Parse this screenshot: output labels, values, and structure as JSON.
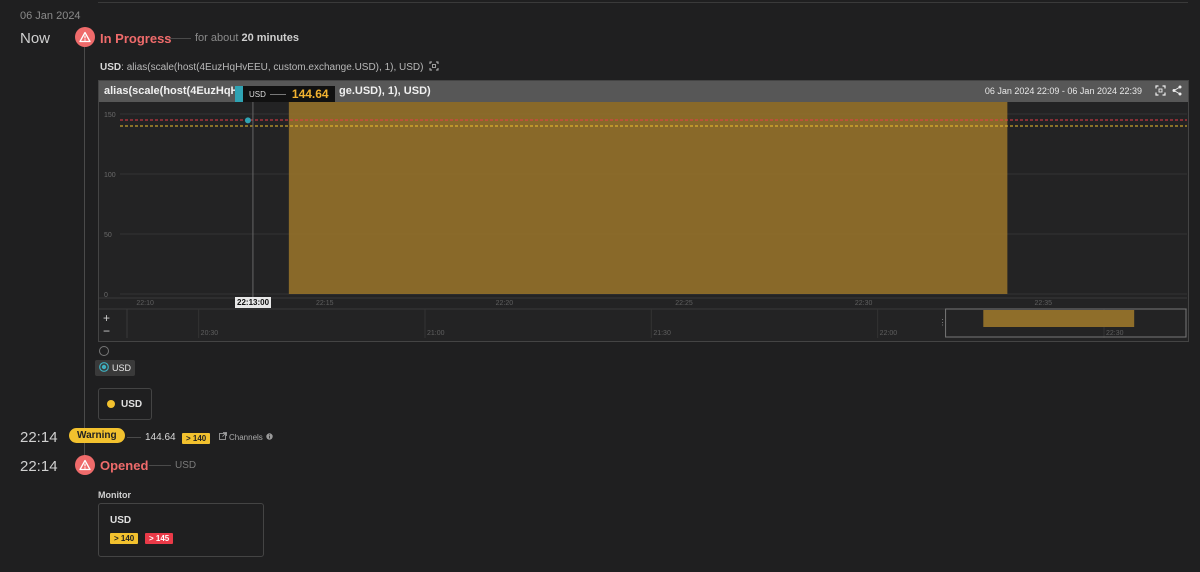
{
  "date_header": "06 Jan 2024",
  "events": [
    {
      "time": "Now",
      "status": "In Progress",
      "duration_prefix": "for about",
      "duration": "20 minutes"
    },
    {
      "time": "22:14",
      "status": "Warning",
      "value": "144.64",
      "threshold": "> 140",
      "channels_label": "Channels"
    },
    {
      "time": "22:14",
      "status": "Opened",
      "target": "USD"
    }
  ],
  "query": {
    "label": "USD",
    "expression": "alias(scale(host(4EuzHqHvEEU, custom.exchange.USD), 1), USD)"
  },
  "panel": {
    "title_left": "alias(scale(host(4EuzHqH",
    "title_right": "ge.USD), 1), USD)",
    "time_range": "06 Jan 2024 22:09 - 06 Jan 2024 22:39",
    "tooltip": {
      "label": "USD",
      "value": "144.64"
    },
    "hover_time": "22:13:00",
    "zoom_in": "+",
    "zoom_out": "−"
  },
  "chart_data": {
    "type": "area",
    "series": [
      {
        "name": "USD",
        "color": "#8f6e2a",
        "x": [
          "22:14",
          "22:34"
        ],
        "values": [
          144.64,
          144.64
        ]
      }
    ],
    "y_ticks": [
      "0",
      "50",
      "100",
      "150"
    ],
    "x_ticks": [
      "22:10",
      "22:15",
      "22:20",
      "22:25",
      "22:30",
      "22:35"
    ],
    "ylim": [
      0,
      160
    ],
    "thresholds": [
      {
        "value": 145,
        "color": "#ea3a48"
      },
      {
        "value": 140,
        "color": "#f2c12e"
      }
    ],
    "navigator_ticks": [
      "20:30",
      "21:00",
      "21:30",
      "22:00",
      "22:30"
    ]
  },
  "series_selector": {
    "label": "USD"
  },
  "legend": {
    "label": "USD"
  },
  "monitor": {
    "heading": "Monitor",
    "name": "USD",
    "thresholds": [
      "> 140",
      "> 145"
    ]
  },
  "colors": {
    "accent_red": "#ef6b6b",
    "warning_yellow": "#f2c12e",
    "series_fill": "#8f6e2a",
    "critical_red": "#ea3a48"
  }
}
